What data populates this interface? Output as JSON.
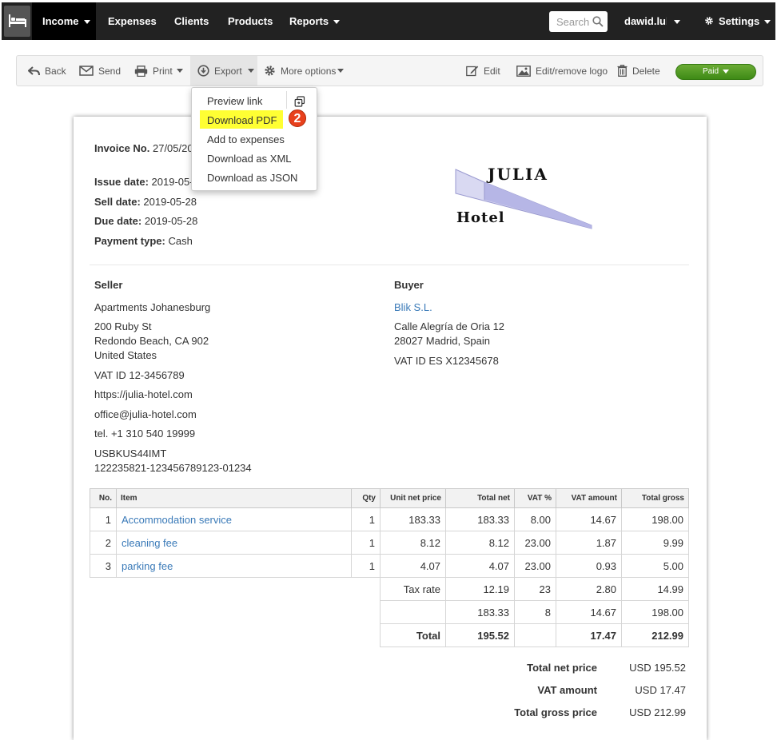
{
  "nav": {
    "items": [
      "Income",
      "Expenses",
      "Clients",
      "Products",
      "Reports"
    ],
    "search_placeholder": "Search",
    "user": "dawid.luk",
    "settings": "Settings"
  },
  "toolbar": {
    "back": "Back",
    "send": "Send",
    "print": "Print",
    "export": "Export",
    "more_options": "More options",
    "edit": "Edit",
    "edit_logo": "Edit/remove logo",
    "delete": "Delete",
    "status": "Paid"
  },
  "export_menu": {
    "items": [
      "Preview link",
      "Download PDF",
      "Add to expenses",
      "Download as XML",
      "Download as JSON"
    ],
    "step_badge": "2"
  },
  "invoice": {
    "number_label": "Invoice No.",
    "number_value": "27/05/20",
    "issue_label": "Issue date:",
    "issue_value": "2019-05-",
    "sell_label": "Sell date:",
    "sell_value": "2019-05-28",
    "due_label": "Due date:",
    "due_value": "2019-05-28",
    "payment_label": "Payment type:",
    "payment_value": "Cash"
  },
  "logo": {
    "line1": "JULIA",
    "line2": "Hotel"
  },
  "seller": {
    "heading": "Seller",
    "name": "Apartments Johanesburg",
    "street": "200 Ruby St",
    "city": "Redondo Beach, CA 902",
    "country": "United States",
    "vat": "VAT ID 12-3456789",
    "website": "https://julia-hotel.com",
    "email": "office@julia-hotel.com",
    "phone": "tel. +1 310 540 19999",
    "swift": "USBKUS44IMT",
    "account": "122235821-123456789123-01234"
  },
  "buyer": {
    "heading": "Buyer",
    "name": "Blik S.L.",
    "street": "Calle Alegría de Oria 12",
    "city": "28027 Madrid, Spain",
    "vat": "VAT ID ES X12345678"
  },
  "table": {
    "headers": [
      "No.",
      "Item",
      "Qty",
      "Unit net price",
      "Total net",
      "VAT %",
      "VAT amount",
      "Total gross"
    ],
    "rows": [
      [
        "1",
        "Accommodation service",
        "1",
        "183.33",
        "183.33",
        "8.00",
        "14.67",
        "198.00"
      ],
      [
        "2",
        "cleaning fee",
        "1",
        "8.12",
        "8.12",
        "23.00",
        "1.87",
        "9.99"
      ],
      [
        "3",
        "parking fee",
        "1",
        "4.07",
        "4.07",
        "23.00",
        "0.93",
        "5.00"
      ]
    ],
    "tax_rows": [
      [
        "Tax rate",
        "12.19",
        "23",
        "2.80",
        "14.99"
      ],
      [
        "",
        "183.33",
        "8",
        "14.67",
        "198.00"
      ]
    ],
    "total_row": [
      "Total",
      "195.52",
      "",
      "17.47",
      "212.99"
    ]
  },
  "summary": {
    "net_label": "Total net price",
    "net_value": "USD 195.52",
    "vat_label": "VAT amount",
    "vat_value": "USD 17.47",
    "gross_label": "Total gross price",
    "gross_value": "USD 212.99"
  }
}
